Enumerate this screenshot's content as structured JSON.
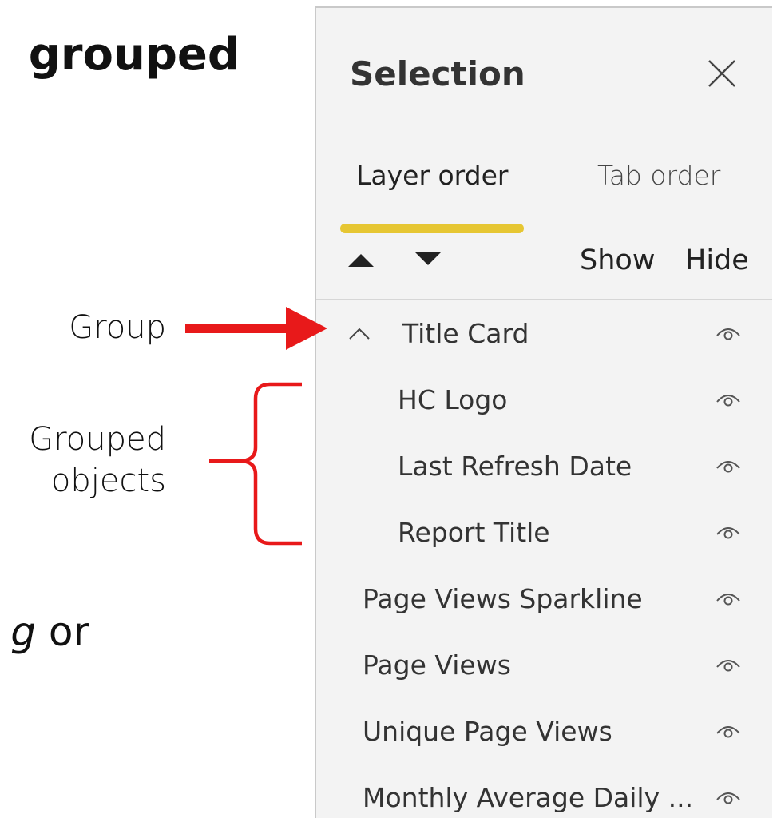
{
  "slide": {
    "heading_fragment": "grouped",
    "body_fragment_italic": "g",
    "body_fragment_tail": " or"
  },
  "annotations": {
    "group_label": "Group",
    "grouped_label_line1": "Grouped",
    "grouped_label_line2": "objects",
    "arrow_color": "#e8191a",
    "bracket_color": "#e8191a"
  },
  "pane": {
    "title": "Selection",
    "close_icon": "close-icon",
    "tabs": [
      {
        "label": "Layer order",
        "active": true
      },
      {
        "label": "Tab order",
        "active": false
      }
    ],
    "active_tab_color": "#e6c632",
    "move_up_icon": "triangle-up-icon",
    "move_down_icon": "triangle-down-icon",
    "show_label": "Show",
    "hide_label": "Hide",
    "layers": [
      {
        "name": "Title Card",
        "type": "group",
        "expanded": true,
        "visible": true
      },
      {
        "name": "HC Logo",
        "type": "child",
        "visible": true
      },
      {
        "name": "Last Refresh Date",
        "type": "child",
        "visible": true
      },
      {
        "name": "Report Title",
        "type": "child",
        "visible": true
      },
      {
        "name": "Page Views Sparkline",
        "type": "root",
        "visible": true
      },
      {
        "name": "Page Views",
        "type": "root",
        "visible": true
      },
      {
        "name": "Unique Page Views",
        "type": "root",
        "visible": true
      },
      {
        "name": "Monthly Average Daily ...",
        "type": "root",
        "visible": true
      }
    ]
  }
}
